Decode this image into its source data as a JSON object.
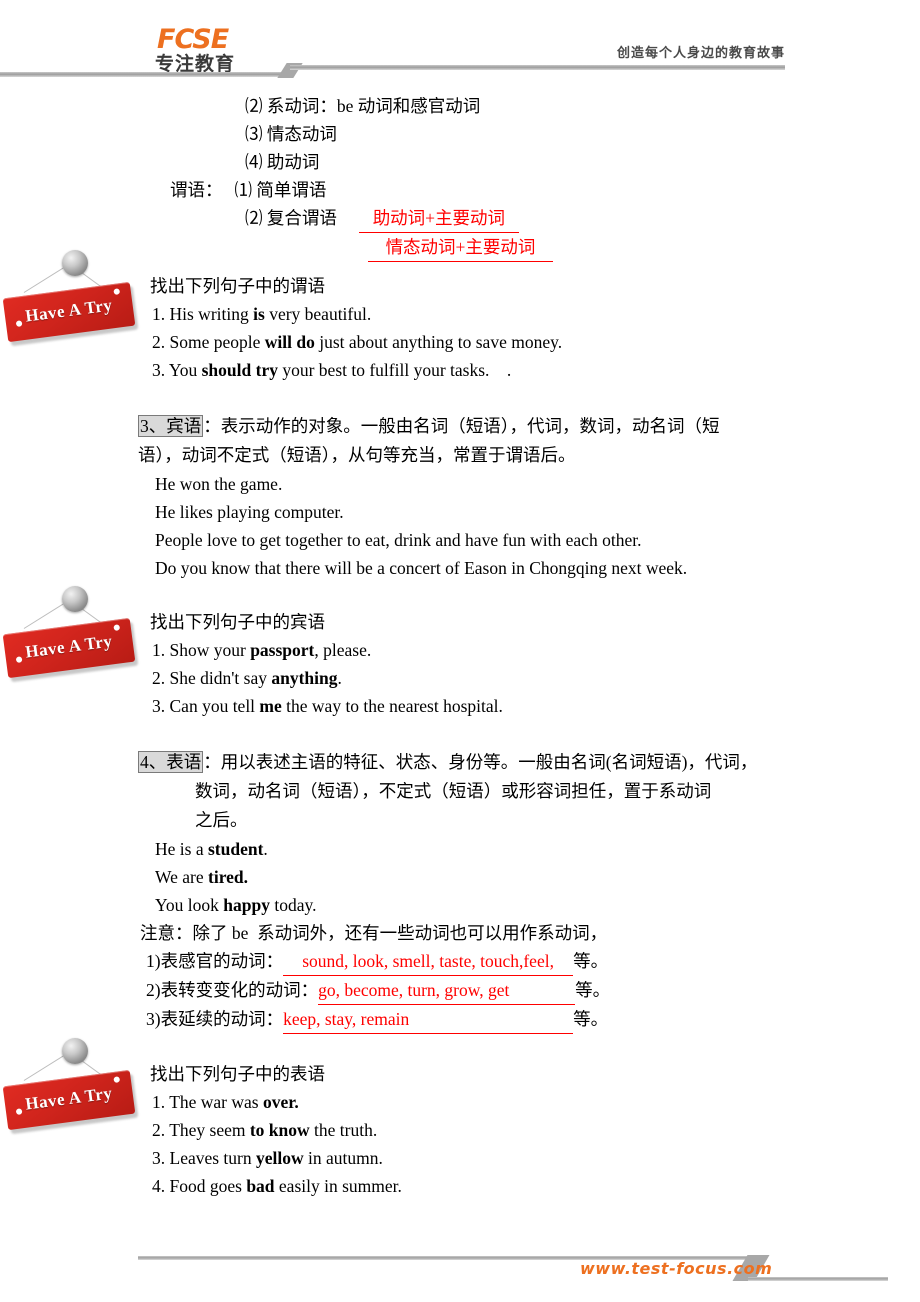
{
  "header": {
    "logo_mark": "FCSE",
    "logo_sub": "专注教育",
    "tagline": "创造每个人身边的教育故事"
  },
  "footer": {
    "url": "www.test-focus.com"
  },
  "badges": {
    "label": "Have A Try"
  },
  "predicate_outline": {
    "item2": "⑵ 系动词：be 动词和感官动词",
    "item3": "⑶ 情态动词",
    "item4": "⑷ 助动词",
    "label": "谓语：",
    "simple": "⑴ 简单谓语",
    "compound": "⑵ 复合谓语",
    "answer1": "助动词+主要动词",
    "answer2": "情态动词+主要动词"
  },
  "exercise1": {
    "prompt": "找出下列句子中的谓语",
    "items": [
      {
        "num": "1. ",
        "pre": "His writing ",
        "bold": "is",
        "post": " very beautiful."
      },
      {
        "num": "2. ",
        "pre": "Some people ",
        "bold": "will do",
        "post": " just about anything to save money."
      },
      {
        "num": "3. ",
        "pre": "You ",
        "bold": "should try",
        "post": " your best to fulfill your tasks.    ."
      }
    ]
  },
  "section3": {
    "heading": "3、宾语",
    "colon": "：",
    "body_line1": "表示动作的对象。一般由名词（短语），代词，数词，动名词（短",
    "body_line2": "语），动词不定式（短语），从句等充当，常置于谓语后。",
    "examples": [
      "He won the game.",
      "He likes playing computer.",
      "People love to get together to eat, drink and have fun with each other.",
      "Do you know that there will be a concert of Eason in Chongqing next week."
    ]
  },
  "exercise2": {
    "prompt": "找出下列句子中的宾语",
    "items": [
      {
        "num": "1. ",
        "pre": "Show your ",
        "bold": "passport",
        "post": ", please."
      },
      {
        "num": "2. ",
        "pre": "She didn't say ",
        "bold": "anything",
        "post": "."
      },
      {
        "num": "3. ",
        "pre": "Can you tell ",
        "bold": "me",
        "post": " the way to the nearest hospital."
      }
    ]
  },
  "section4": {
    "heading": "4、表语",
    "colon": "：",
    "body_line1": "用以表述主语的特征、状态、身份等。一般由名词(名词短语)，代词，",
    "body_line2": "数词，动名词（短语），不定式（短语）或形容词担任，置于系动词",
    "body_line3": "之后。",
    "examples": [
      {
        "pre": "He is a ",
        "bold": "student",
        "post": "."
      },
      {
        "pre": "We are ",
        "bold": "tired.",
        "post": ""
      },
      {
        "pre": "You look ",
        "bold": "happy",
        "post": " today."
      }
    ],
    "note": "注意：除了 be  系动词外，还有一些动词也可以用作系动词，",
    "fills": [
      {
        "label": "1)表感官的动词：",
        "answer": "sound, look, smell, taste, touch,feel,",
        "tail": "等。"
      },
      {
        "label": "2)表转变变化的动词：",
        "answer": "go, become, turn, grow, get",
        "tail": "等。"
      },
      {
        "label": "3)表延续的动词：",
        "answer": "keep, stay, remain",
        "tail": "等。"
      }
    ]
  },
  "exercise3": {
    "prompt": "找出下列句子中的表语",
    "items": [
      {
        "num": "1. ",
        "pre": "The war was ",
        "bold": "over.",
        "post": ""
      },
      {
        "num": "2. ",
        "pre": "They seem ",
        "bold": "to know",
        "post": " the truth."
      },
      {
        "num": "3. ",
        "pre": "Leaves turn ",
        "bold": "yellow",
        "post": " in autumn."
      },
      {
        "num": "4. ",
        "pre": "Food goes ",
        "bold": "bad",
        "post": " easily in summer."
      }
    ]
  }
}
